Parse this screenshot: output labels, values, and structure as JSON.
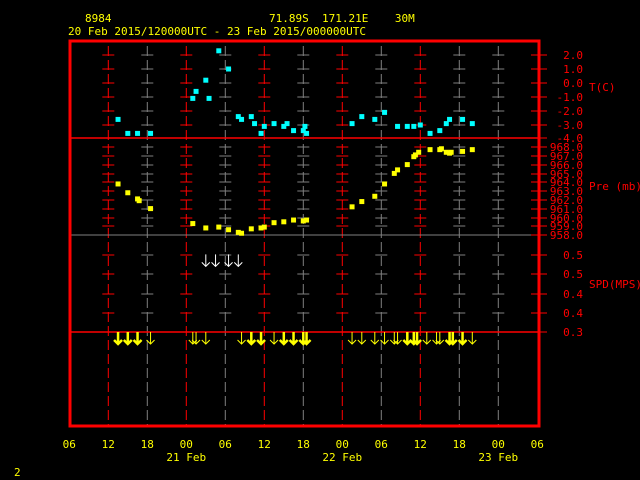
{
  "header": {
    "station_id": "8984",
    "location": "71.89S  171.21E    30M",
    "period": "20 Feb 2015/120000UTC - 23 Feb 2015/000000UTC"
  },
  "footer": {
    "page_number": "2"
  },
  "colors": {
    "frame": "#ff0000",
    "grid_minor": "#808080",
    "text": "#ffff00",
    "temperature": "#00ffff",
    "pressure": "#ffff00",
    "wind_arrow": "#ffff00",
    "wind_arrow_upper": "#ffffff"
  },
  "chart_data": {
    "type": "scatter",
    "x_axis": {
      "tick_labels": [
        "06",
        "12",
        "18",
        "00",
        "06",
        "12",
        "18",
        "00",
        "06",
        "12",
        "18",
        "00",
        "06"
      ],
      "date_labels": [
        "21 Feb",
        "22 Feb",
        "23 Feb"
      ],
      "range": [
        "20 06:00",
        "23 06:00"
      ]
    },
    "panels": [
      {
        "id": "temperature",
        "label": "T(C)",
        "tick_labels": [
          "2.0",
          "1.0",
          "0.0",
          "-1.0",
          "-2.0",
          "-3.0",
          "-4.0"
        ],
        "ylim": [
          -4.0,
          3.0
        ],
        "points": [
          [
            "20 13:30",
            -2.6
          ],
          [
            "20 15:00",
            -3.6
          ],
          [
            "20 16:30",
            -3.6
          ],
          [
            "20 18:30",
            -3.6
          ],
          [
            "21 01:00",
            -1.1
          ],
          [
            "21 01:30",
            -0.6
          ],
          [
            "21 03:00",
            0.2
          ],
          [
            "21 03:30",
            -1.1
          ],
          [
            "21 05:00",
            2.3
          ],
          [
            "21 06:30",
            1.0
          ],
          [
            "21 08:00",
            -2.4
          ],
          [
            "21 08:30",
            -2.6
          ],
          [
            "21 10:00",
            -2.4
          ],
          [
            "21 10:30",
            -2.9
          ],
          [
            "21 11:30",
            -3.6
          ],
          [
            "21 12:00",
            -3.1
          ],
          [
            "21 13:30",
            -2.9
          ],
          [
            "21 15:00",
            -3.1
          ],
          [
            "21 15:30",
            -2.9
          ],
          [
            "21 16:30",
            -3.4
          ],
          [
            "21 18:00",
            -3.4
          ],
          [
            "21 18:15",
            -3.1
          ],
          [
            "21 18:30",
            -3.6
          ],
          [
            "22 01:30",
            -2.9
          ],
          [
            "22 03:00",
            -2.4
          ],
          [
            "22 05:00",
            -2.6
          ],
          [
            "22 06:30",
            -2.1
          ],
          [
            "22 08:30",
            -3.1
          ],
          [
            "22 10:00",
            -3.1
          ],
          [
            "22 11:00",
            -3.1
          ],
          [
            "22 12:00",
            -3.0
          ],
          [
            "22 13:30",
            -3.6
          ],
          [
            "22 15:00",
            -3.4
          ],
          [
            "22 16:00",
            -2.9
          ],
          [
            "22 16:30",
            -2.6
          ],
          [
            "22 18:30",
            -2.6
          ],
          [
            "22 20:00",
            -2.9
          ]
        ]
      },
      {
        "id": "pressure",
        "label": "Pre (mb)",
        "tick_labels": [
          "968.0",
          "967.0",
          "966.0",
          "965.0",
          "964.0",
          "963.0",
          "962.0",
          "961.0",
          "960.0",
          "959.0",
          "958.0"
        ],
        "ylim": [
          958.0,
          969.0
        ],
        "points": [
          [
            "20 13:30",
            963.8
          ],
          [
            "20 15:00",
            962.8
          ],
          [
            "20 16:30",
            962.1
          ],
          [
            "20 16:45",
            961.9
          ],
          [
            "20 18:30",
            961.0
          ],
          [
            "21 01:00",
            959.3
          ],
          [
            "21 03:00",
            958.8
          ],
          [
            "21 05:00",
            958.9
          ],
          [
            "21 06:30",
            958.6
          ],
          [
            "21 08:00",
            958.3
          ],
          [
            "21 08:30",
            958.2
          ],
          [
            "21 10:00",
            958.7
          ],
          [
            "21 11:30",
            958.8
          ],
          [
            "21 12:00",
            958.9
          ],
          [
            "21 13:30",
            959.4
          ],
          [
            "21 15:00",
            959.5
          ],
          [
            "21 16:30",
            959.7
          ],
          [
            "21 18:00",
            959.6
          ],
          [
            "21 18:30",
            959.7
          ],
          [
            "22 01:30",
            961.2
          ],
          [
            "22 03:00",
            961.8
          ],
          [
            "22 05:00",
            962.4
          ],
          [
            "22 06:30",
            963.8
          ],
          [
            "22 08:00",
            965.0
          ],
          [
            "22 08:30",
            965.4
          ],
          [
            "22 10:00",
            966.0
          ],
          [
            "22 11:00",
            966.9
          ],
          [
            "22 11:15",
            967.1
          ],
          [
            "22 11:45",
            967.4
          ],
          [
            "22 13:30",
            967.7
          ],
          [
            "22 15:00",
            967.7
          ],
          [
            "22 15:15",
            967.8
          ],
          [
            "22 16:00",
            967.4
          ],
          [
            "22 16:30",
            967.3
          ],
          [
            "22 16:45",
            967.4
          ],
          [
            "22 18:30",
            967.5
          ],
          [
            "22 20:00",
            967.7
          ]
        ]
      },
      {
        "id": "wind_speed",
        "label": "SPD(MPS)",
        "tick_labels": [
          "0.5",
          "0.5",
          "0.4",
          "0.4",
          "0.3"
        ],
        "ylim": [
          0.3,
          0.55
        ],
        "arrows": [
          {
            "t": "20 13:30",
            "v": 0.3,
            "bold": true
          },
          {
            "t": "20 15:00",
            "v": 0.3,
            "bold": true
          },
          {
            "t": "20 16:30",
            "v": 0.3,
            "bold": true
          },
          {
            "t": "20 18:30",
            "v": 0.3,
            "bold": false
          },
          {
            "t": "21 01:00",
            "v": 0.3,
            "bold": false
          },
          {
            "t": "21 01:30",
            "v": 0.3,
            "bold": false
          },
          {
            "t": "21 03:00",
            "v": 0.3,
            "bold": false
          },
          {
            "t": "21 03:00",
            "v": 0.5,
            "bold": false,
            "upper": true
          },
          {
            "t": "21 04:30",
            "v": 0.5,
            "bold": false,
            "upper": true
          },
          {
            "t": "21 06:30",
            "v": 0.5,
            "bold": false,
            "upper": true
          },
          {
            "t": "21 08:00",
            "v": 0.5,
            "bold": false,
            "upper": true
          },
          {
            "t": "21 08:30",
            "v": 0.3,
            "bold": false
          },
          {
            "t": "21 10:00",
            "v": 0.3,
            "bold": true
          },
          {
            "t": "21 11:30",
            "v": 0.3,
            "bold": true
          },
          {
            "t": "21 13:30",
            "v": 0.3,
            "bold": false
          },
          {
            "t": "21 15:00",
            "v": 0.3,
            "bold": true
          },
          {
            "t": "21 16:30",
            "v": 0.3,
            "bold": true
          },
          {
            "t": "21 18:00",
            "v": 0.3,
            "bold": true
          },
          {
            "t": "21 18:30",
            "v": 0.3,
            "bold": true
          },
          {
            "t": "22 01:30",
            "v": 0.3,
            "bold": false
          },
          {
            "t": "22 03:00",
            "v": 0.3,
            "bold": false
          },
          {
            "t": "22 05:00",
            "v": 0.3,
            "bold": false
          },
          {
            "t": "22 06:30",
            "v": 0.3,
            "bold": false
          },
          {
            "t": "22 08:00",
            "v": 0.3,
            "bold": false
          },
          {
            "t": "22 08:30",
            "v": 0.3,
            "bold": false
          },
          {
            "t": "22 10:00",
            "v": 0.3,
            "bold": true
          },
          {
            "t": "22 11:00",
            "v": 0.3,
            "bold": true
          },
          {
            "t": "22 11:30",
            "v": 0.3,
            "bold": true
          },
          {
            "t": "22 13:00",
            "v": 0.3,
            "bold": false
          },
          {
            "t": "22 14:30",
            "v": 0.3,
            "bold": false
          },
          {
            "t": "22 15:00",
            "v": 0.3,
            "bold": false
          },
          {
            "t": "22 16:30",
            "v": 0.3,
            "bold": true
          },
          {
            "t": "22 17:00",
            "v": 0.3,
            "bold": true
          },
          {
            "t": "22 18:30",
            "v": 0.3,
            "bold": true
          },
          {
            "t": "22 20:00",
            "v": 0.3,
            "bold": false
          }
        ]
      }
    ]
  }
}
